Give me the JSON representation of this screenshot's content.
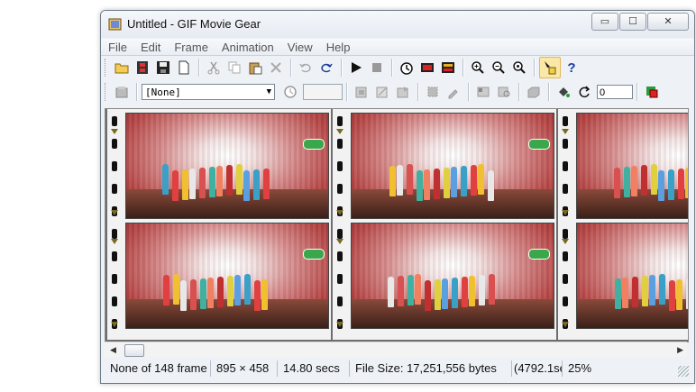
{
  "window": {
    "title": "Untitled - GIF Movie Gear",
    "controls": {
      "minimize": "▭",
      "maximize": "☐",
      "close": "✕"
    }
  },
  "menu": [
    "File",
    "Edit",
    "Frame",
    "Animation",
    "View",
    "Help"
  ],
  "toolbar1": [
    {
      "name": "open-icon",
      "glyph": "📂"
    },
    {
      "name": "film-icon",
      "glyph": "🎞"
    },
    {
      "name": "save-icon",
      "glyph": "💾"
    },
    {
      "name": "new-icon",
      "glyph": "🗋"
    },
    {
      "name": "cut-icon",
      "glyph": "✂"
    },
    {
      "name": "copy-icon",
      "glyph": "⎘"
    },
    {
      "name": "paste-icon",
      "glyph": "📋"
    },
    {
      "name": "delete-icon",
      "glyph": "✕"
    },
    {
      "name": "undo-icon",
      "glyph": "↶"
    },
    {
      "name": "redo-icon",
      "glyph": "↷"
    },
    {
      "name": "play-icon",
      "glyph": "▶"
    },
    {
      "name": "stop-icon",
      "glyph": "■"
    },
    {
      "name": "timing-icon",
      "glyph": "⏱"
    },
    {
      "name": "filmstrip-icon",
      "glyph": "▤"
    },
    {
      "name": "filmstrip-alt-icon",
      "glyph": "▥"
    },
    {
      "name": "zoom-in-icon",
      "glyph": "🔍"
    },
    {
      "name": "zoom-out-icon",
      "glyph": "🔍"
    },
    {
      "name": "zoom-fit-icon",
      "glyph": "🔍"
    },
    {
      "name": "selection-info-icon",
      "glyph": "ℹ"
    },
    {
      "name": "help-icon",
      "glyph": "?"
    }
  ],
  "toolbar2": {
    "combo_value": "[None]",
    "delay_value": "",
    "loop_value": "0"
  },
  "status": {
    "frames": "None of 148 frame",
    "dimensions": "895 × 458",
    "duration": "14.80 secs",
    "filesize": "File Size: 17,251,556 bytes",
    "rate": "(4792.1secs",
    "zoom": "25%"
  },
  "colors": {
    "window_bg": "#eef2f7",
    "film_gray": "#6e6e6e",
    "stage_red": "#b84848",
    "logo_green": "#3aa84a"
  }
}
